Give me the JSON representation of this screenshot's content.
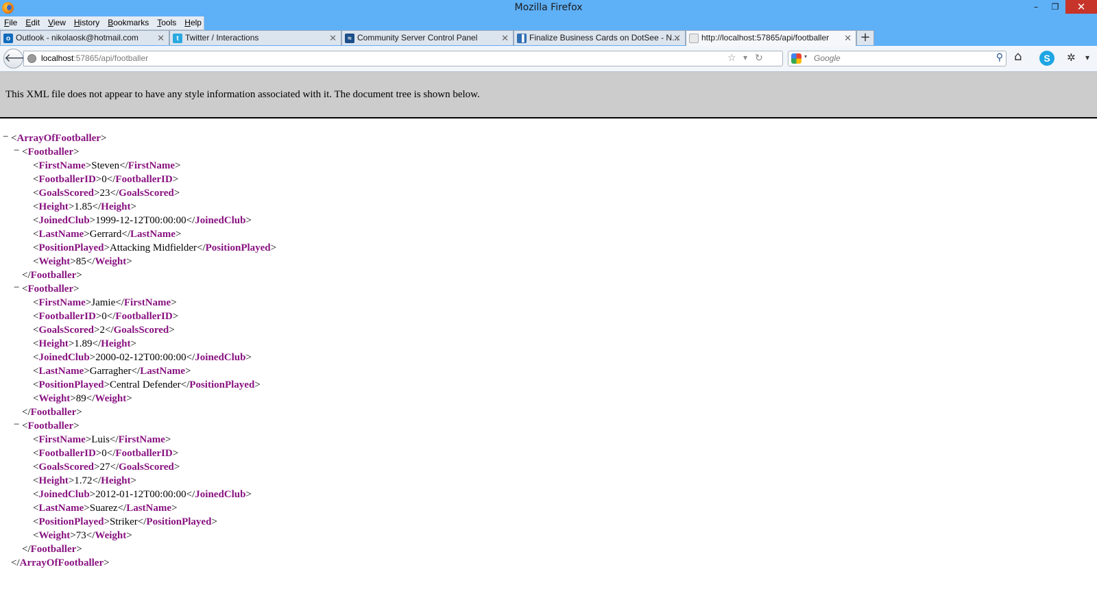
{
  "window": {
    "title": "Mozilla Firefox",
    "min_glyph": "–",
    "max_glyph": "❐",
    "close_glyph": "✕"
  },
  "menu": [
    "File",
    "Edit",
    "View",
    "History",
    "Bookmarks",
    "Tools",
    "Help"
  ],
  "tabs": [
    {
      "label": "Outlook - nikolaosk@hotmail.com",
      "icon": "outlook-icon",
      "icon_color": "#0f6cbd",
      "icon_text": "o"
    },
    {
      "label": "Twitter / Interactions",
      "icon": "twitter-icon",
      "icon_color": "#2aa9e0",
      "icon_text": "t"
    },
    {
      "label": "Community Server Control Panel",
      "icon": "community-server-icon",
      "icon_color": "#1c4f8a",
      "icon_text": "≈"
    },
    {
      "label": "Finalize Business Cards on DotSee - N...",
      "icon": "trello-icon",
      "icon_color": "#2f6fb3",
      "icon_text": "▐"
    },
    {
      "label": "http://localhost:57865/api/footballer",
      "icon": "page-icon",
      "icon_color": "#e8e8e8",
      "icon_text": ""
    }
  ],
  "tab_close_glyph": "✕",
  "new_tab_glyph": "+",
  "navbar": {
    "back_glyph": "🡐",
    "url_host": "localhost",
    "url_rest": ":57865/api/footballer",
    "search_placeholder": "Google",
    "star_glyph": "☆",
    "dropdown_glyph": "▾",
    "reload_glyph": "↻",
    "search_glyph": "⚲",
    "home_glyph": "⌂",
    "skype_glyph": "S",
    "addon_glyph": "✲",
    "menu_glyph": "▾"
  },
  "xml_notice": "This XML file does not appear to have any style information associated with it. The document tree is shown below.",
  "xml": {
    "root": "ArrayOfFootballer",
    "item": "Footballer",
    "collapse_glyph": "−",
    "footballers": [
      {
        "fields": [
          {
            "name": "FirstName",
            "value": "Steven"
          },
          {
            "name": "FootballerID",
            "value": "0"
          },
          {
            "name": "GoalsScored",
            "value": "23"
          },
          {
            "name": "Height",
            "value": "1.85"
          },
          {
            "name": "JoinedClub",
            "value": "1999-12-12T00:00:00"
          },
          {
            "name": "LastName",
            "value": "Gerrard"
          },
          {
            "name": "PositionPlayed",
            "value": "Attacking Midfielder"
          },
          {
            "name": "Weight",
            "value": "85"
          }
        ]
      },
      {
        "fields": [
          {
            "name": "FirstName",
            "value": "Jamie"
          },
          {
            "name": "FootballerID",
            "value": "0"
          },
          {
            "name": "GoalsScored",
            "value": "2"
          },
          {
            "name": "Height",
            "value": "1.89"
          },
          {
            "name": "JoinedClub",
            "value": "2000-02-12T00:00:00"
          },
          {
            "name": "LastName",
            "value": "Garragher"
          },
          {
            "name": "PositionPlayed",
            "value": "Central Defender"
          },
          {
            "name": "Weight",
            "value": "89"
          }
        ]
      },
      {
        "fields": [
          {
            "name": "FirstName",
            "value": "Luis"
          },
          {
            "name": "FootballerID",
            "value": "0"
          },
          {
            "name": "GoalsScored",
            "value": "27"
          },
          {
            "name": "Height",
            "value": "1.72"
          },
          {
            "name": "JoinedClub",
            "value": "2012-01-12T00:00:00"
          },
          {
            "name": "LastName",
            "value": "Suarez"
          },
          {
            "name": "PositionPlayed",
            "value": "Striker"
          },
          {
            "name": "Weight",
            "value": "73"
          }
        ]
      }
    ]
  }
}
